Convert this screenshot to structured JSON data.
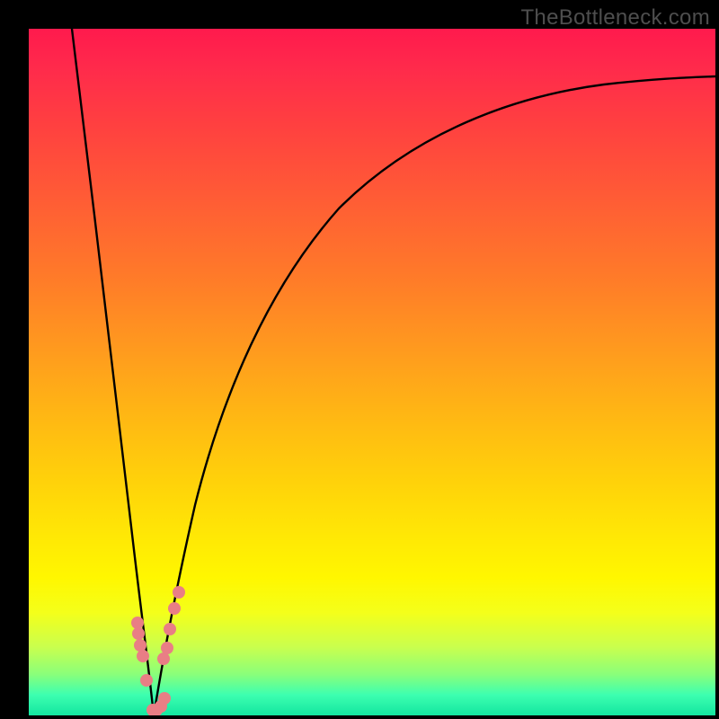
{
  "watermark": {
    "text": "TheBottleneck.com"
  },
  "colors": {
    "gradient_top": "#ff1a4d",
    "gradient_bottom": "#13e6a0",
    "frame": "#000000",
    "curve": "#000000",
    "dots": "#e97e85"
  },
  "chart_data": {
    "type": "line",
    "title": "",
    "xlabel": "",
    "ylabel": "",
    "x_range_fraction": [
      0,
      1
    ],
    "ylim_percent": [
      0,
      100
    ],
    "grid": false,
    "legend": false,
    "left_branch": {
      "description": "steep descending branch approaching zero bottleneck at min",
      "x": [
        0.063,
        0.08,
        0.1,
        0.12,
        0.14,
        0.155,
        0.17,
        0.182
      ],
      "y_percent": [
        100,
        80,
        57,
        37,
        20,
        10,
        4,
        0
      ]
    },
    "right_branch": {
      "description": "rising branch, concave, asymptotically approaching high bottleneck",
      "x": [
        0.182,
        0.2,
        0.22,
        0.25,
        0.3,
        0.36,
        0.44,
        0.54,
        0.66,
        0.8,
        0.92,
        1.0
      ],
      "y_percent": [
        0,
        9,
        20,
        33,
        49,
        61,
        71,
        79,
        85,
        89,
        91.5,
        93
      ]
    },
    "minimum_x_fraction": 0.182,
    "highlight_dots": {
      "left_of_min": {
        "x": [
          0.158,
          0.16,
          0.163,
          0.166,
          0.172
        ],
        "y_percent": [
          13.5,
          12.0,
          10.2,
          8.6,
          5.0
        ]
      },
      "right_of_min": {
        "x": [
          0.197,
          0.201,
          0.206,
          0.212,
          0.218
        ],
        "y_percent": [
          8.2,
          9.8,
          12.5,
          15.5,
          18.0
        ]
      },
      "at_min": {
        "x": [
          0.18,
          0.186,
          0.192,
          0.198
        ],
        "y_percent": [
          0.8,
          0.8,
          1.3,
          2.5
        ]
      }
    }
  }
}
